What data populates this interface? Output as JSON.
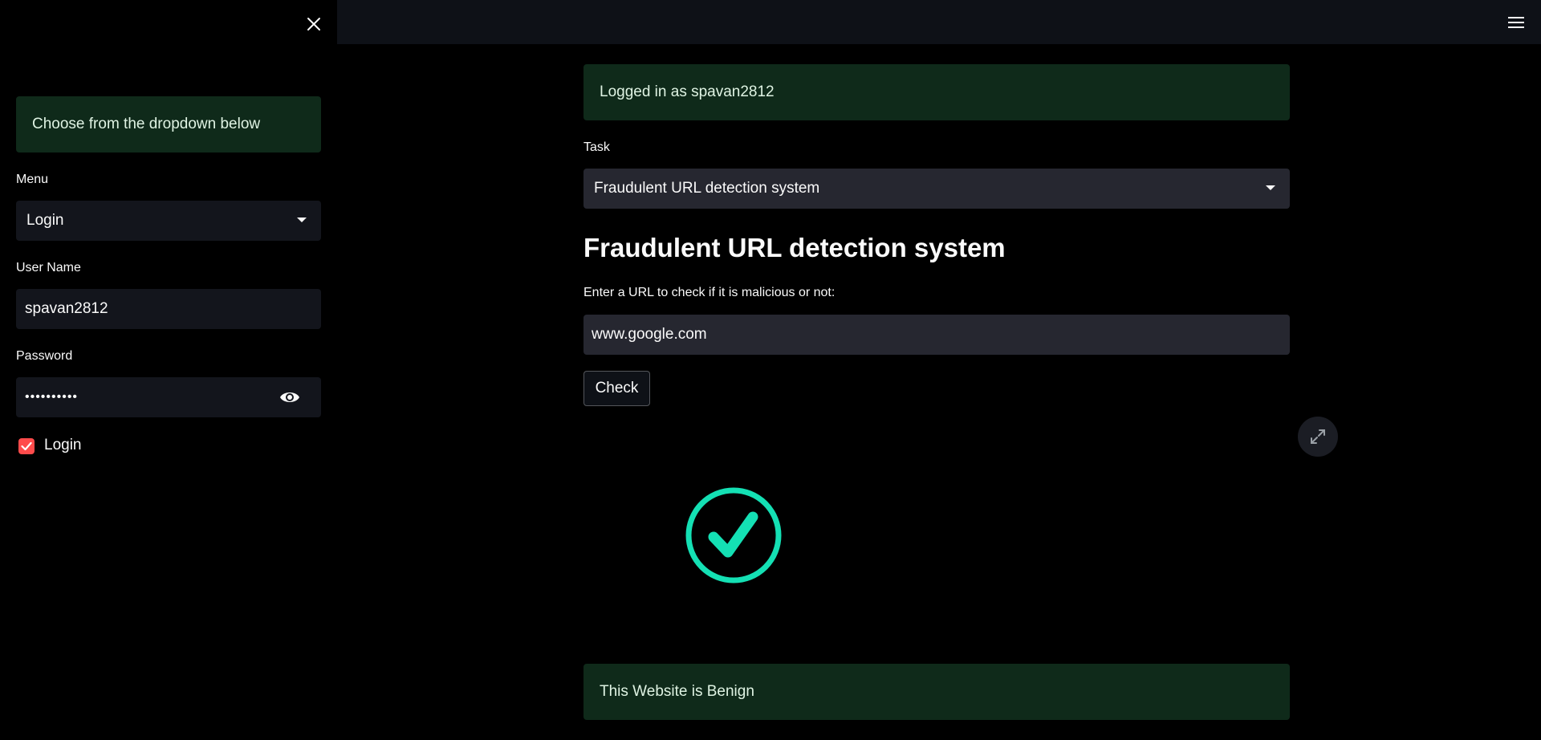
{
  "sidebar": {
    "info_text": "Choose from the dropdown below",
    "menu_label": "Menu",
    "menu_value": "Login",
    "username_label": "User Name",
    "username_value": "spavan2812",
    "password_label": "Password",
    "password_value": "••••••••••",
    "login_checkbox_label": "Login",
    "login_checked": true
  },
  "main": {
    "logged_in_text": "Logged in as spavan2812",
    "task_label": "Task",
    "task_value": "Fraudulent URL detection system",
    "title": "Fraudulent URL detection system",
    "url_label": "Enter a URL to check if it is malicious or not:",
    "url_value": "www.google.com",
    "check_button": "Check",
    "result_text": "This Website is Benign"
  },
  "icons": {
    "close": "close-icon",
    "hamburger": "menu-icon",
    "dropdown": "chevron-down-icon",
    "show_password": "eye-icon",
    "expand": "expand-icon",
    "success": "checkmark-circle-icon"
  },
  "colors": {
    "background": "#000000",
    "topbar": "#0e1117",
    "success_bg": "#0f2a1a",
    "input_bg": "#262730",
    "sidebar_input_bg": "#13151c",
    "accent_red": "#ff4b4b",
    "success_teal": "#14e0b4"
  }
}
